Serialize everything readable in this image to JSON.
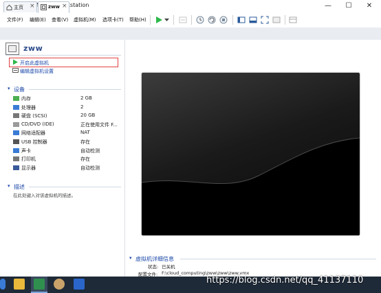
{
  "window": {
    "title": "zww - VMware Workstation",
    "minimize": "—",
    "maximize": "☐",
    "close": "✕"
  },
  "menu": [
    "文件(F)",
    "编辑(E)",
    "查看(V)",
    "虚拟机(M)",
    "选项卡(T)",
    "帮助(H)"
  ],
  "tabs": [
    {
      "label": "主页",
      "icon": "home-icon",
      "close": "×"
    },
    {
      "label": "zww",
      "icon": "vm-icon",
      "close": "×"
    }
  ],
  "vm": {
    "name": "zww",
    "actions": {
      "power_on": "开启此虚拟机",
      "edit_settings": "编辑虚拟机设置"
    }
  },
  "devices": {
    "title": "设备",
    "items": [
      {
        "name": "内存",
        "value": "2 GB",
        "icon": "memory-icon"
      },
      {
        "name": "处理器",
        "value": "2",
        "icon": "cpu-icon"
      },
      {
        "name": "硬盘 (SCSI)",
        "value": "20 GB",
        "icon": "hard-disk-icon"
      },
      {
        "name": "CD/DVD (IDE)",
        "value": "正在使用文件 F...",
        "icon": "cd-dvd-icon"
      },
      {
        "name": "网络适配器",
        "value": "NAT",
        "icon": "network-adapter-icon"
      },
      {
        "name": "USB 控制器",
        "value": "存在",
        "icon": "usb-icon"
      },
      {
        "name": "声卡",
        "value": "自动检测",
        "icon": "sound-card-icon"
      },
      {
        "name": "打印机",
        "value": "存在",
        "icon": "printer-icon"
      },
      {
        "name": "显示器",
        "value": "自动检测",
        "icon": "display-icon"
      }
    ]
  },
  "description": {
    "title": "描述",
    "placeholder": "在此处键入对该虚拟机的描述。"
  },
  "details": {
    "title": "虚拟机详细信息",
    "status_label": "状态:",
    "status_value": "已关机",
    "config_label": "配置文件:",
    "config_value": "F:\\cloud_computing\\zww\\zww\\zww.vmx"
  },
  "watermark": "https://blog.csdn.net/qq_41137110",
  "colors": {
    "link": "#1a47a8",
    "highlight_border": "#e04040",
    "taskbar": "#1f2a38",
    "play_green": "#2db84b"
  }
}
